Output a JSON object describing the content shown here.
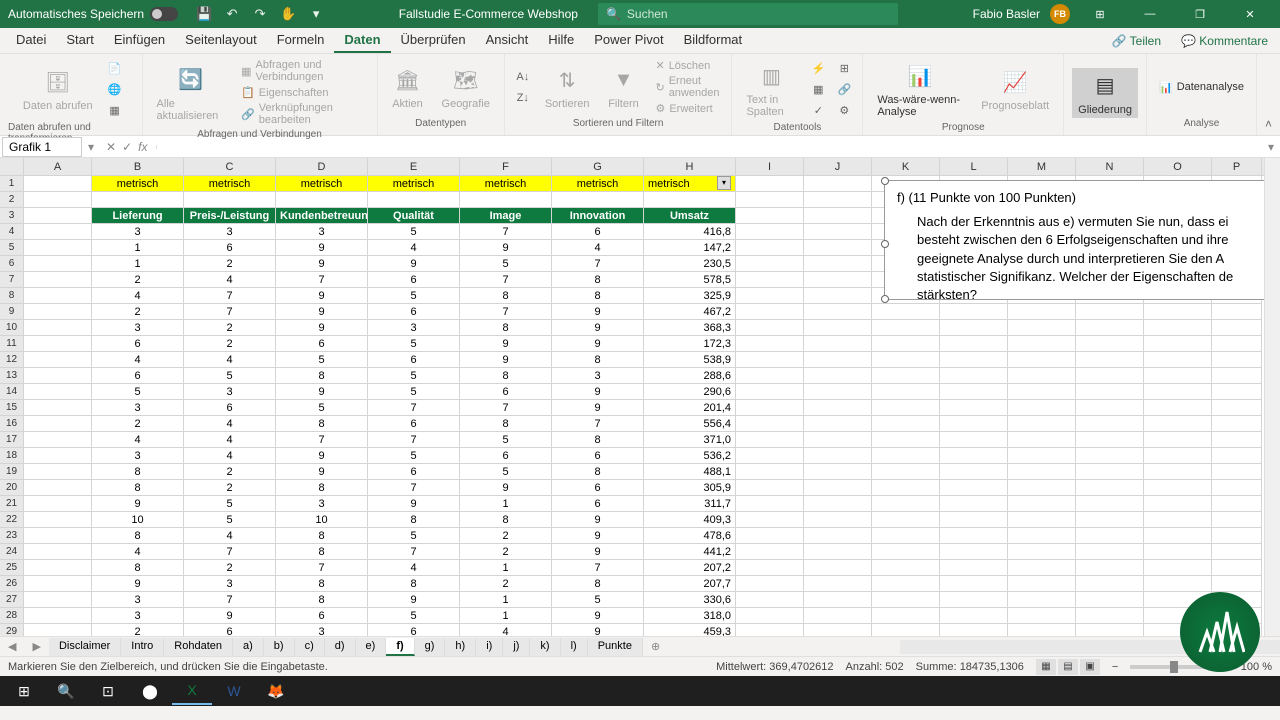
{
  "titlebar": {
    "autosave": "Automatisches Speichern",
    "doc_title": "Fallstudie E-Commerce Webshop",
    "search_placeholder": "Suchen",
    "user_name": "Fabio Basler",
    "user_initials": "FB"
  },
  "menu": {
    "tabs": [
      "Datei",
      "Start",
      "Einfügen",
      "Seitenlayout",
      "Formeln",
      "Daten",
      "Überprüfen",
      "Ansicht",
      "Hilfe",
      "Power Pivot",
      "Bildformat"
    ],
    "active": "Daten",
    "share": "Teilen",
    "comments": "Kommentare"
  },
  "ribbon": {
    "g1": {
      "btn1": "Daten abrufen",
      "btn2": "",
      "label": "Daten abrufen und transformieren"
    },
    "g2": {
      "btn1": "Alle aktualisieren",
      "s1": "Abfragen und Verbindungen",
      "s2": "Eigenschaften",
      "s3": "Verknüpfungen bearbeiten",
      "label": "Abfragen und Verbindungen"
    },
    "g3": {
      "btn1": "Aktien",
      "btn2": "Geografie",
      "label": "Datentypen"
    },
    "g4": {
      "btn1": "Sortieren",
      "btn2": "Filtern",
      "s1": "Löschen",
      "s2": "Erneut anwenden",
      "s3": "Erweitert",
      "label": "Sortieren und Filtern"
    },
    "g5": {
      "btn1": "Text in Spalten",
      "label": "Datentools"
    },
    "g6": {
      "btn1": "Was-wäre-wenn-Analyse",
      "btn2": "Prognoseblatt",
      "label": "Prognose"
    },
    "g7": {
      "btn1": "Gliederung",
      "label": ""
    },
    "g8": {
      "btn1": "Datenanalyse",
      "label": "Analyse"
    }
  },
  "formula": {
    "name_box": "Grafik 1",
    "value": ""
  },
  "columns": [
    "A",
    "B",
    "C",
    "D",
    "E",
    "F",
    "G",
    "H",
    "I",
    "J",
    "K",
    "L",
    "M",
    "N",
    "O",
    "P"
  ],
  "row1": [
    "metrisch",
    "metrisch",
    "metrisch",
    "metrisch",
    "metrisch",
    "metrisch",
    "metrisch"
  ],
  "headers": [
    "Lieferung",
    "Preis-/Leistung",
    "Kundenbetreuung",
    "Qualität",
    "Image",
    "Innovation",
    "Umsatz"
  ],
  "data_rows": [
    [
      3,
      3,
      3,
      5,
      7,
      6,
      "416,8"
    ],
    [
      1,
      6,
      9,
      4,
      9,
      4,
      "147,2"
    ],
    [
      1,
      2,
      9,
      9,
      5,
      7,
      "230,5"
    ],
    [
      2,
      4,
      7,
      6,
      7,
      8,
      "578,5"
    ],
    [
      4,
      7,
      9,
      5,
      8,
      8,
      "325,9"
    ],
    [
      2,
      7,
      9,
      6,
      7,
      9,
      "467,2"
    ],
    [
      3,
      2,
      9,
      3,
      8,
      9,
      "368,3"
    ],
    [
      6,
      2,
      6,
      5,
      9,
      9,
      "172,3"
    ],
    [
      4,
      4,
      5,
      6,
      9,
      8,
      "538,9"
    ],
    [
      6,
      5,
      8,
      5,
      8,
      3,
      "288,6"
    ],
    [
      5,
      3,
      9,
      5,
      6,
      9,
      "290,6"
    ],
    [
      3,
      6,
      5,
      7,
      7,
      9,
      "201,4"
    ],
    [
      2,
      4,
      8,
      6,
      8,
      7,
      "556,4"
    ],
    [
      4,
      4,
      7,
      7,
      5,
      8,
      "371,0"
    ],
    [
      3,
      4,
      9,
      5,
      6,
      6,
      "536,2"
    ],
    [
      8,
      2,
      9,
      6,
      5,
      8,
      "488,1"
    ],
    [
      8,
      2,
      8,
      7,
      9,
      6,
      "305,9"
    ],
    [
      9,
      5,
      3,
      9,
      1,
      6,
      "311,7"
    ],
    [
      10,
      5,
      10,
      8,
      8,
      9,
      "409,3"
    ],
    [
      8,
      4,
      8,
      5,
      2,
      9,
      "478,6"
    ],
    [
      4,
      7,
      8,
      7,
      2,
      9,
      "441,2"
    ],
    [
      8,
      2,
      7,
      4,
      1,
      7,
      "207,2"
    ],
    [
      9,
      3,
      8,
      8,
      2,
      8,
      "207,7"
    ],
    [
      3,
      7,
      8,
      9,
      1,
      5,
      "330,6"
    ],
    [
      3,
      9,
      6,
      5,
      1,
      9,
      "318,0"
    ],
    [
      2,
      6,
      3,
      6,
      4,
      9,
      "459,3"
    ]
  ],
  "textbox": {
    "title": "f) (11 Punkte von 100 Punkten)",
    "body": "Nach der Erkenntnis aus e) vermuten Sie nun, dass ei besteht zwischen den 6 Erfolgseigenschaften und ihre geeignete Analyse durch und interpretieren Sie den A statistischer Signifikanz. Welcher der Eigenschaften de stärksten?"
  },
  "sheets": {
    "tabs": [
      "Disclaimer",
      "Intro",
      "Rohdaten",
      "a)",
      "b)",
      "c)",
      "d)",
      "e)",
      "f)",
      "g)",
      "h)",
      "i)",
      "j)",
      "k)",
      "l)",
      "Punkte"
    ],
    "active": "f)"
  },
  "status": {
    "msg": "Markieren Sie den Zielbereich, und drücken Sie die Eingabetaste.",
    "avg_label": "Mittelwert:",
    "avg": "369,4702612",
    "count_label": "Anzahl:",
    "count": "502",
    "sum_label": "Summe:",
    "sum": "184735,1306",
    "zoom": "100 %"
  }
}
